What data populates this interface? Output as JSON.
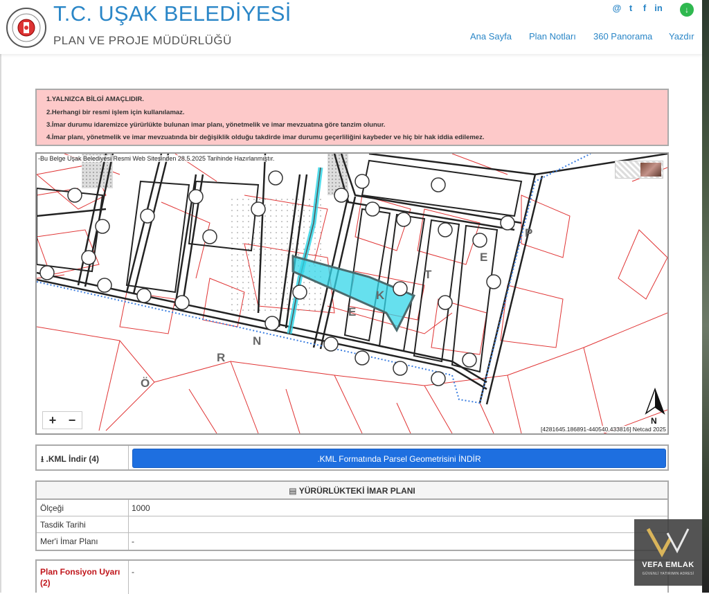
{
  "header": {
    "title": "T.C. UŞAK BELEDİYESİ",
    "subtitle": "PLAN VE PROJE MÜDÜRLÜĞÜ",
    "logo_icon": "municipality-seal-icon",
    "social_icons": [
      "at-icon",
      "twitter-icon",
      "facebook-icon",
      "linkedin-icon"
    ],
    "social_glyphs": [
      "@",
      "t",
      "f",
      "in"
    ],
    "download_glyph": "↓",
    "nav": [
      "Ana Sayfa",
      "Plan Notları",
      "360 Panorama",
      "Yazdır"
    ]
  },
  "warning": {
    "lines": [
      "1.YALNIZCA BİLGİ AMAÇLIDIR.",
      "2.Herhangi bir resmi işlem için kullanılamaz.",
      "3.İmar durumu idaremizce yürürlükte bulunan imar planı, yönetmelik ve imar mevzuatına göre tanzim olunur.",
      "4.İmar planı, yönetmelik ve imar mevzuatında bir değişiklik olduğu takdirde imar durumu geçerliliğini kaybeder ve hiç bir hak iddia edilemez."
    ]
  },
  "map": {
    "caption": "-Bu Belge Uşak Belediyesi Resmi Web Sitesinden 28.5.2025 Tarihinde Hazırlanmıştır.",
    "coords": "[4281645.186891-440540.433816] Netcad 2025",
    "zoom_in": "+",
    "zoom_out": "−",
    "north_label": "N",
    "road_letters": [
      "Ö",
      "R",
      "N",
      "E",
      "K",
      "T",
      "E",
      "P"
    ]
  },
  "kml": {
    "label": ".KML İndir (4)",
    "button": ".KML Formatında Parsel Geometrisini İNDİR"
  },
  "plan": {
    "heading": "YÜRÜRLÜKTEKİ İMAR PLANI",
    "rows": [
      {
        "key": "Ölçeği",
        "value": "1000"
      },
      {
        "key": "Tasdik Tarihi",
        "value": ""
      },
      {
        "key": "Mer'i İmar Planı",
        "value": "-"
      }
    ],
    "fonksiyon": {
      "key": "Plan Fonsiyon Uyarı (2)",
      "value": "-"
    }
  },
  "watermark": {
    "brand": "VEFA EMLAK",
    "tagline": "GÜVENLİ YATIRIMIN ADRESİ"
  },
  "colors": {
    "accent": "#2a86c7",
    "warning_bg": "#fdc9c9",
    "button": "#1e6fe0",
    "parcel_highlight": "#33d6e8",
    "parcel_lines": "#e03434"
  }
}
